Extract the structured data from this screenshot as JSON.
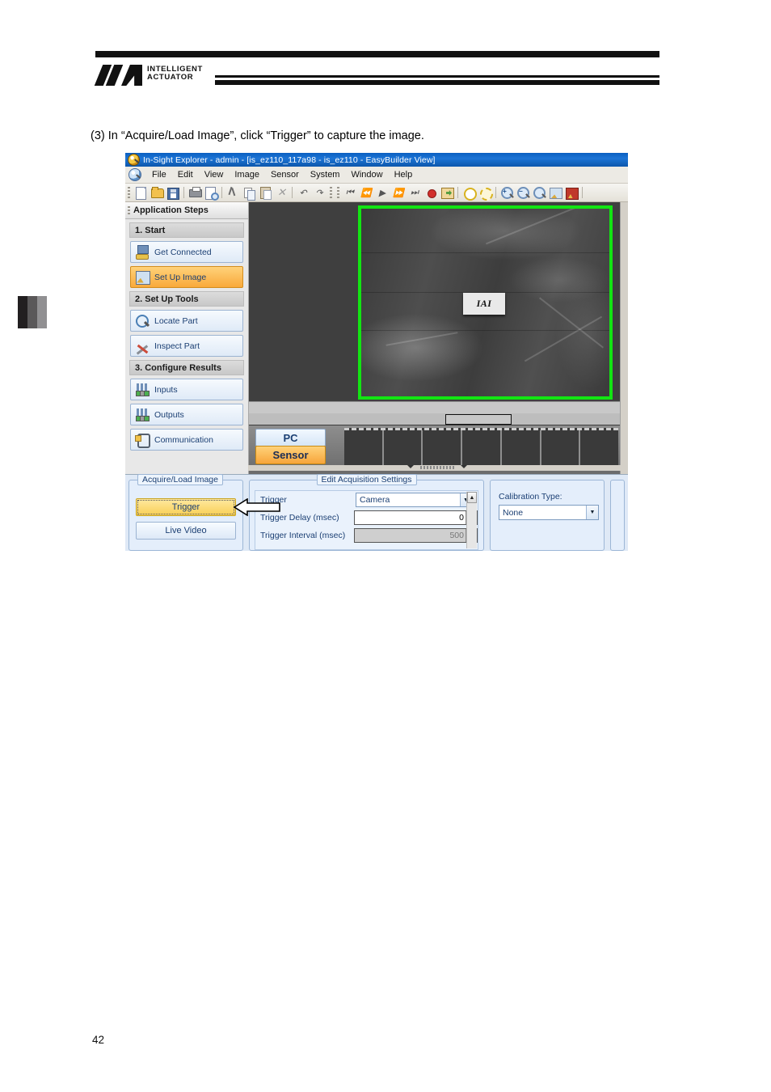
{
  "document": {
    "brand": {
      "line1": "INTELLIGENT",
      "line2": "ACTUATOR"
    },
    "step_text": "(3)  In “Acquire/Load Image”, click “Trigger” to capture the image.",
    "page_number": "42"
  },
  "app": {
    "title": "In-Sight Explorer - admin - [is_ez110_117a98 - is_ez110 - EasyBuilder View]",
    "menu": [
      "File",
      "Edit",
      "View",
      "Image",
      "Sensor",
      "System",
      "Window",
      "Help"
    ],
    "toolbar_icons": [
      "new-document-icon",
      "open-folder-icon",
      "save-icon",
      "print-icon",
      "print-preview-icon",
      "cut-icon",
      "copy-icon",
      "paste-icon",
      "delete-icon",
      "undo-icon",
      "redo-icon",
      "first-record-icon",
      "rewind-icon",
      "play-icon",
      "fast-forward-icon",
      "last-record-icon",
      "record-icon",
      "export-icon",
      "online-icon",
      "offline-icon",
      "zoom-in-icon",
      "zoom-out-icon",
      "zoom-fit-icon",
      "image-refresh-icon",
      "filmstrip-icon"
    ]
  },
  "sidebar": {
    "header": "Application Steps",
    "groups": [
      {
        "title": "1. Start",
        "items": [
          {
            "label": "Get Connected",
            "icon": "connect-icon",
            "active": false
          },
          {
            "label": "Set Up Image",
            "icon": "setup-image-icon",
            "active": true
          }
        ]
      },
      {
        "title": "2. Set Up Tools",
        "items": [
          {
            "label": "Locate Part",
            "icon": "magnifier-icon",
            "active": false
          },
          {
            "label": "Inspect Part",
            "icon": "tools-icon",
            "active": false
          }
        ]
      },
      {
        "title": "3. Configure Results",
        "items": [
          {
            "label": "Inputs",
            "icon": "inputs-icon",
            "active": false
          },
          {
            "label": "Outputs",
            "icon": "outputs-icon",
            "active": false
          },
          {
            "label": "Communication",
            "icon": "communication-icon",
            "active": false
          }
        ]
      }
    ],
    "collapse_icon": "chevron-down-icon"
  },
  "viewer": {
    "part_label": "IAI",
    "roi_color": "#12e512",
    "source_tabs": [
      {
        "label": "PC",
        "selected": false
      },
      {
        "label": "Sensor",
        "selected": true
      }
    ],
    "filmstrip_cells": 7
  },
  "bottom": {
    "acquire_pane": {
      "title": "Acquire/Load Image",
      "trigger_button": "Trigger",
      "live_video_button": "Live Video",
      "callout_icon": "left-arrow-callout-icon"
    },
    "acquisition_pane": {
      "title": "Edit Acquisition Settings",
      "rows": [
        {
          "label": "Trigger",
          "type": "combo",
          "value": "Camera",
          "disabled": false
        },
        {
          "label": "Trigger Delay (msec)",
          "type": "spin",
          "value": "0",
          "disabled": false
        },
        {
          "label": "Trigger Interval (msec)",
          "type": "spin",
          "value": "500",
          "disabled": true
        }
      ]
    },
    "calibration_pane": {
      "label": "Calibration Type:",
      "value": "None"
    }
  }
}
